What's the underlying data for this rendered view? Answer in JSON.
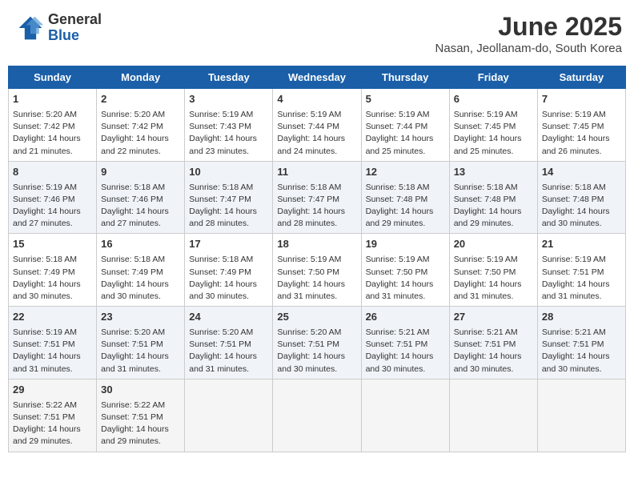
{
  "header": {
    "logo_general": "General",
    "logo_blue": "Blue",
    "month": "June 2025",
    "location": "Nasan, Jeollanam-do, South Korea"
  },
  "weekdays": [
    "Sunday",
    "Monday",
    "Tuesday",
    "Wednesday",
    "Thursday",
    "Friday",
    "Saturday"
  ],
  "weeks": [
    [
      {
        "day": "1",
        "sunrise": "Sunrise: 5:20 AM",
        "sunset": "Sunset: 7:42 PM",
        "daylight": "Daylight: 14 hours and 21 minutes."
      },
      {
        "day": "2",
        "sunrise": "Sunrise: 5:20 AM",
        "sunset": "Sunset: 7:42 PM",
        "daylight": "Daylight: 14 hours and 22 minutes."
      },
      {
        "day": "3",
        "sunrise": "Sunrise: 5:19 AM",
        "sunset": "Sunset: 7:43 PM",
        "daylight": "Daylight: 14 hours and 23 minutes."
      },
      {
        "day": "4",
        "sunrise": "Sunrise: 5:19 AM",
        "sunset": "Sunset: 7:44 PM",
        "daylight": "Daylight: 14 hours and 24 minutes."
      },
      {
        "day": "5",
        "sunrise": "Sunrise: 5:19 AM",
        "sunset": "Sunset: 7:44 PM",
        "daylight": "Daylight: 14 hours and 25 minutes."
      },
      {
        "day": "6",
        "sunrise": "Sunrise: 5:19 AM",
        "sunset": "Sunset: 7:45 PM",
        "daylight": "Daylight: 14 hours and 25 minutes."
      },
      {
        "day": "7",
        "sunrise": "Sunrise: 5:19 AM",
        "sunset": "Sunset: 7:45 PM",
        "daylight": "Daylight: 14 hours and 26 minutes."
      }
    ],
    [
      {
        "day": "8",
        "sunrise": "Sunrise: 5:19 AM",
        "sunset": "Sunset: 7:46 PM",
        "daylight": "Daylight: 14 hours and 27 minutes."
      },
      {
        "day": "9",
        "sunrise": "Sunrise: 5:18 AM",
        "sunset": "Sunset: 7:46 PM",
        "daylight": "Daylight: 14 hours and 27 minutes."
      },
      {
        "day": "10",
        "sunrise": "Sunrise: 5:18 AM",
        "sunset": "Sunset: 7:47 PM",
        "daylight": "Daylight: 14 hours and 28 minutes."
      },
      {
        "day": "11",
        "sunrise": "Sunrise: 5:18 AM",
        "sunset": "Sunset: 7:47 PM",
        "daylight": "Daylight: 14 hours and 28 minutes."
      },
      {
        "day": "12",
        "sunrise": "Sunrise: 5:18 AM",
        "sunset": "Sunset: 7:48 PM",
        "daylight": "Daylight: 14 hours and 29 minutes."
      },
      {
        "day": "13",
        "sunrise": "Sunrise: 5:18 AM",
        "sunset": "Sunset: 7:48 PM",
        "daylight": "Daylight: 14 hours and 29 minutes."
      },
      {
        "day": "14",
        "sunrise": "Sunrise: 5:18 AM",
        "sunset": "Sunset: 7:48 PM",
        "daylight": "Daylight: 14 hours and 30 minutes."
      }
    ],
    [
      {
        "day": "15",
        "sunrise": "Sunrise: 5:18 AM",
        "sunset": "Sunset: 7:49 PM",
        "daylight": "Daylight: 14 hours and 30 minutes."
      },
      {
        "day": "16",
        "sunrise": "Sunrise: 5:18 AM",
        "sunset": "Sunset: 7:49 PM",
        "daylight": "Daylight: 14 hours and 30 minutes."
      },
      {
        "day": "17",
        "sunrise": "Sunrise: 5:18 AM",
        "sunset": "Sunset: 7:49 PM",
        "daylight": "Daylight: 14 hours and 30 minutes."
      },
      {
        "day": "18",
        "sunrise": "Sunrise: 5:19 AM",
        "sunset": "Sunset: 7:50 PM",
        "daylight": "Daylight: 14 hours and 31 minutes."
      },
      {
        "day": "19",
        "sunrise": "Sunrise: 5:19 AM",
        "sunset": "Sunset: 7:50 PM",
        "daylight": "Daylight: 14 hours and 31 minutes."
      },
      {
        "day": "20",
        "sunrise": "Sunrise: 5:19 AM",
        "sunset": "Sunset: 7:50 PM",
        "daylight": "Daylight: 14 hours and 31 minutes."
      },
      {
        "day": "21",
        "sunrise": "Sunrise: 5:19 AM",
        "sunset": "Sunset: 7:51 PM",
        "daylight": "Daylight: 14 hours and 31 minutes."
      }
    ],
    [
      {
        "day": "22",
        "sunrise": "Sunrise: 5:19 AM",
        "sunset": "Sunset: 7:51 PM",
        "daylight": "Daylight: 14 hours and 31 minutes."
      },
      {
        "day": "23",
        "sunrise": "Sunrise: 5:20 AM",
        "sunset": "Sunset: 7:51 PM",
        "daylight": "Daylight: 14 hours and 31 minutes."
      },
      {
        "day": "24",
        "sunrise": "Sunrise: 5:20 AM",
        "sunset": "Sunset: 7:51 PM",
        "daylight": "Daylight: 14 hours and 31 minutes."
      },
      {
        "day": "25",
        "sunrise": "Sunrise: 5:20 AM",
        "sunset": "Sunset: 7:51 PM",
        "daylight": "Daylight: 14 hours and 30 minutes."
      },
      {
        "day": "26",
        "sunrise": "Sunrise: 5:21 AM",
        "sunset": "Sunset: 7:51 PM",
        "daylight": "Daylight: 14 hours and 30 minutes."
      },
      {
        "day": "27",
        "sunrise": "Sunrise: 5:21 AM",
        "sunset": "Sunset: 7:51 PM",
        "daylight": "Daylight: 14 hours and 30 minutes."
      },
      {
        "day": "28",
        "sunrise": "Sunrise: 5:21 AM",
        "sunset": "Sunset: 7:51 PM",
        "daylight": "Daylight: 14 hours and 30 minutes."
      }
    ],
    [
      {
        "day": "29",
        "sunrise": "Sunrise: 5:22 AM",
        "sunset": "Sunset: 7:51 PM",
        "daylight": "Daylight: 14 hours and 29 minutes."
      },
      {
        "day": "30",
        "sunrise": "Sunrise: 5:22 AM",
        "sunset": "Sunset: 7:51 PM",
        "daylight": "Daylight: 14 hours and 29 minutes."
      },
      null,
      null,
      null,
      null,
      null
    ]
  ]
}
